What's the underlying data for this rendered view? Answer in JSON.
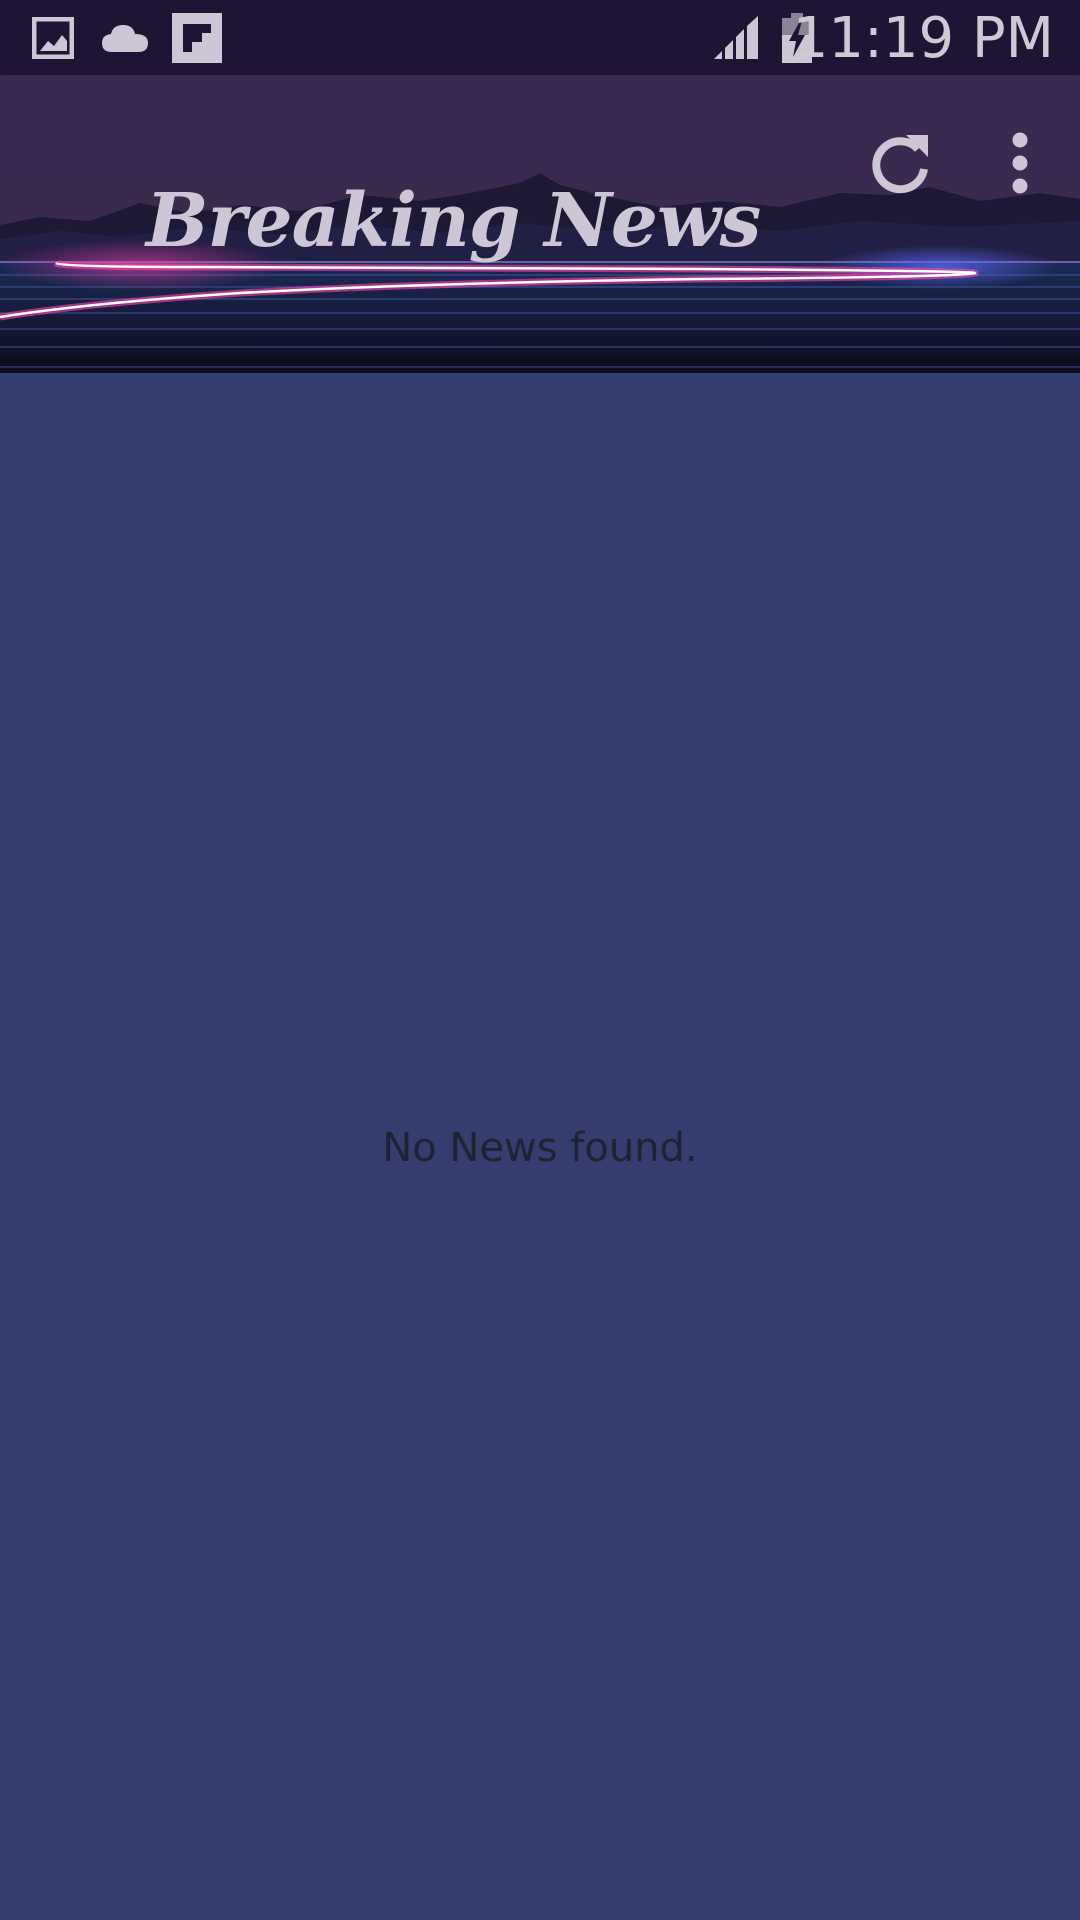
{
  "status_bar": {
    "time": "11:19 PM",
    "icons": [
      "gallery-icon",
      "cloud-icon",
      "flipboard-icon",
      "signal-icon",
      "battery-charging-icon"
    ]
  },
  "app_bar": {
    "title": "Breaking News",
    "actions": [
      "refresh-icon",
      "more-vert-icon"
    ]
  },
  "main": {
    "empty_message": "No News found."
  },
  "colors": {
    "status_bar_bg": "#1f1434",
    "app_bar_bg": "#3b2a50",
    "content_bg": "#343d6e",
    "icon_tint": "#cdc6d4",
    "neon_pink": "#ff3fb0",
    "neon_blue": "#5a6cff"
  }
}
